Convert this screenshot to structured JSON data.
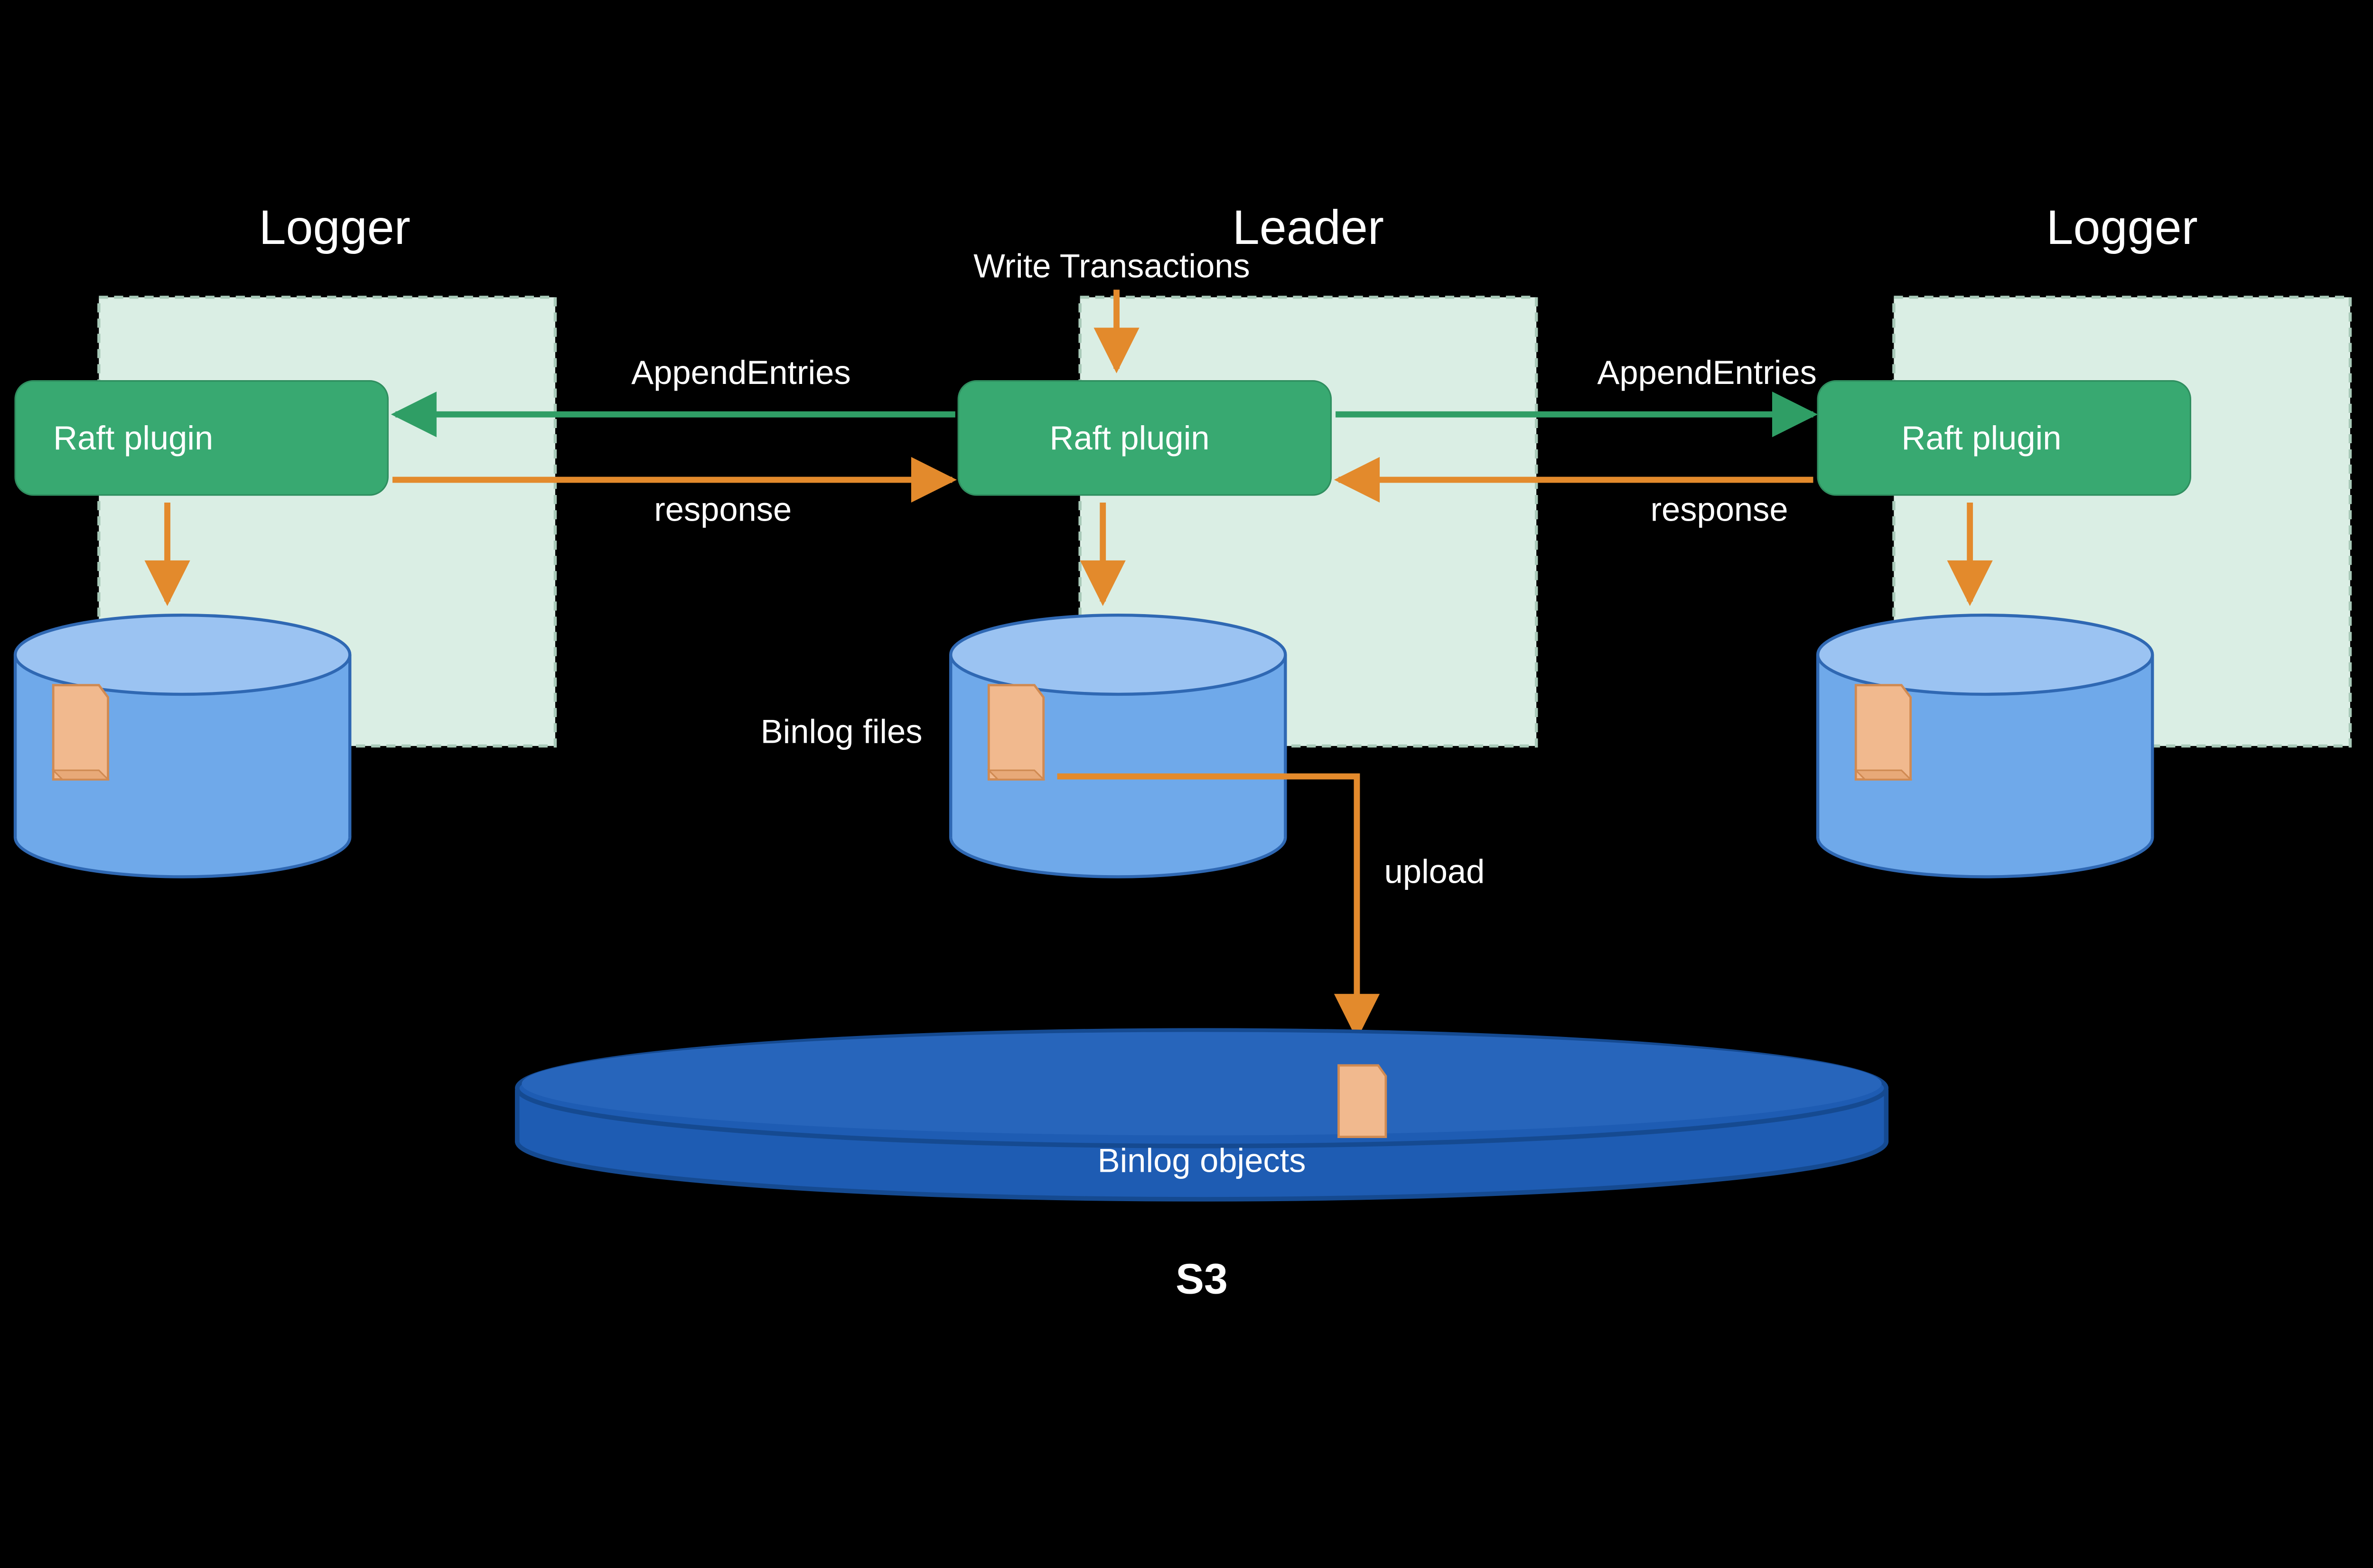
{
  "roles": {
    "left": {
      "title": "Logger",
      "raft_label": "Raft plugin"
    },
    "mid": {
      "title": "Leader",
      "raft_label": "Raft plugin"
    },
    "right": {
      "title": "Logger",
      "raft_label": "Raft plugin"
    }
  },
  "labels": {
    "write_tx": "Write Transactions",
    "append_left": "AppendEntries",
    "append_right": "AppendEntries",
    "response_left": "response",
    "response_right": "response",
    "binlog_files": "Binlog files",
    "upload": "upload",
    "binlog_objects": "Binlog objects",
    "s3": "S3"
  },
  "colors": {
    "node_fill": "#daeee4",
    "node_stroke": "#a8c9b8",
    "raft_fill": "#38a971",
    "raft_stroke": "#2f8e5f",
    "disk_top": "#9bc3f2",
    "disk_side": "#6fa9ea",
    "disk_stroke": "#2f68b3",
    "file_fill": "#f1b98e",
    "file_stroke": "#d08a52",
    "arrow_green": "#2f9e65",
    "arrow_orange": "#e38a2c",
    "s3_fill": "#1e5cb3",
    "s3_stroke": "#154a91"
  },
  "chart_data": {
    "type": "diagram",
    "nodes": [
      {
        "id": "logger_left",
        "role": "Logger",
        "component": "Raft plugin",
        "storage": "local binlog disk"
      },
      {
        "id": "leader",
        "role": "Leader",
        "component": "Raft plugin",
        "storage": "local binlog disk"
      },
      {
        "id": "logger_right",
        "role": "Logger",
        "component": "Raft plugin",
        "storage": "local binlog disk"
      },
      {
        "id": "s3",
        "role": "S3",
        "content": "Binlog objects"
      }
    ],
    "edges": [
      {
        "from": "external",
        "to": "leader",
        "label": "Write Transactions",
        "style": "orange"
      },
      {
        "from": "leader",
        "to": "logger_left",
        "label": "AppendEntries",
        "style": "green"
      },
      {
        "from": "leader",
        "to": "logger_right",
        "label": "AppendEntries",
        "style": "green"
      },
      {
        "from": "logger_left",
        "to": "leader",
        "label": "response",
        "style": "orange"
      },
      {
        "from": "logger_right",
        "to": "leader",
        "label": "response",
        "style": "orange"
      },
      {
        "from": "leader",
        "to": "local_disk",
        "label": "",
        "style": "orange"
      },
      {
        "from": "logger_left",
        "to": "local_disk",
        "label": "",
        "style": "orange"
      },
      {
        "from": "logger_right",
        "to": "local_disk",
        "label": "",
        "style": "orange"
      },
      {
        "from": "leader_disk",
        "to": "s3",
        "label": "upload",
        "style": "orange",
        "note": "Binlog files → Binlog objects"
      }
    ]
  }
}
